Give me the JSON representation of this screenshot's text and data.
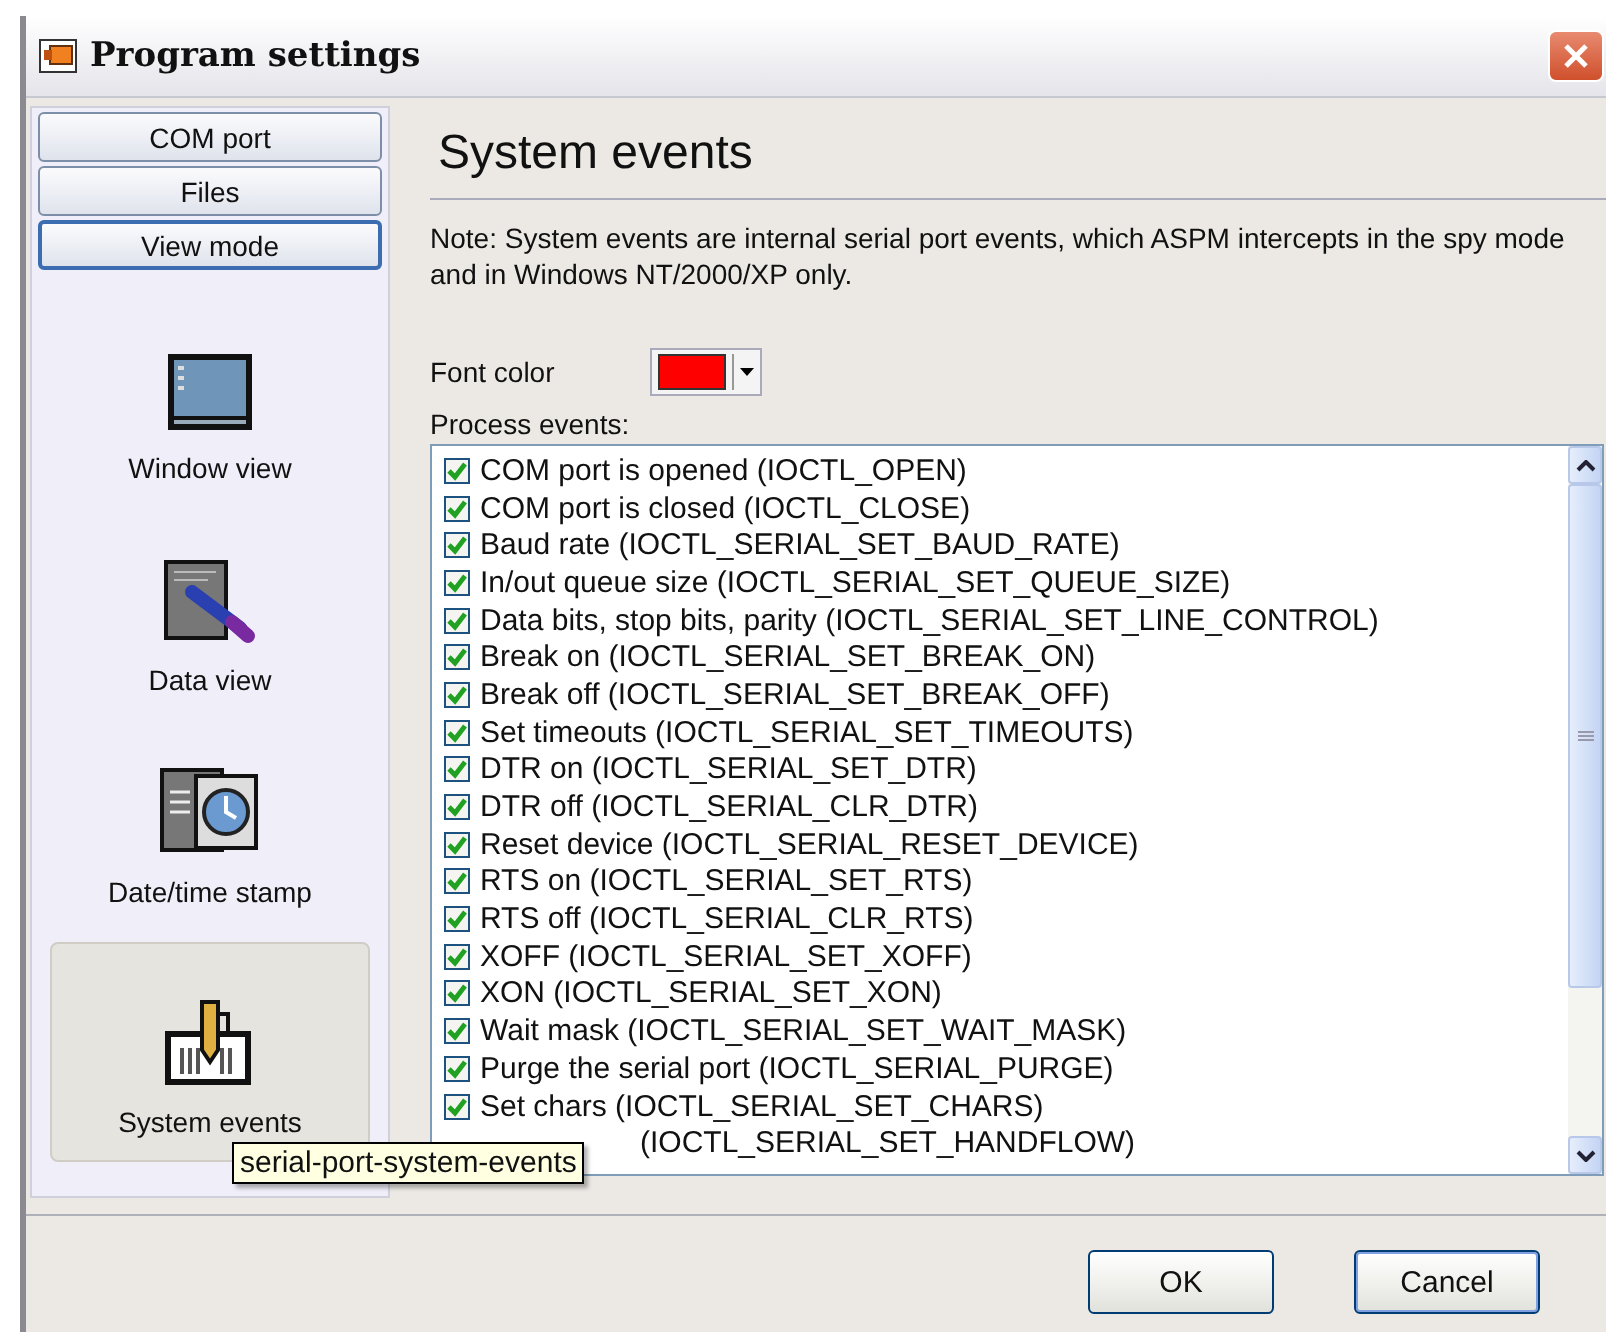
{
  "window": {
    "title": "Program settings"
  },
  "nav_buttons": [
    {
      "label": "COM port",
      "selected": false
    },
    {
      "label": "Files",
      "selected": false
    },
    {
      "label": "View mode",
      "selected": true
    }
  ],
  "view_items": [
    {
      "label": "Window view",
      "kind": "window",
      "selected": false
    },
    {
      "label": "Data view",
      "kind": "data",
      "selected": false
    },
    {
      "label": "Date/time stamp",
      "kind": "clock",
      "selected": false
    },
    {
      "label": "System events",
      "kind": "events",
      "selected": true
    }
  ],
  "panel": {
    "title": "System events",
    "note": "Note: System events are internal serial port events, which ASPM intercepts in the spy mode and in Windows NT/2000/XP only.",
    "font_color": {
      "label": "Font color",
      "color": "#ff0000"
    },
    "list_label": "Process events:"
  },
  "events": [
    {
      "kind": "check",
      "label": "COM port is opened (IOCTL_OPEN)",
      "checked": true
    },
    {
      "kind": "check",
      "label": "COM port is closed (IOCTL_CLOSE)",
      "checked": true
    },
    {
      "kind": "check",
      "label": "Baud rate (IOCTL_SERIAL_SET_BAUD_RATE)",
      "checked": true
    },
    {
      "kind": "check",
      "label": "In/out queue size (IOCTL_SERIAL_SET_QUEUE_SIZE)",
      "checked": true
    },
    {
      "kind": "check",
      "label": "Data bits, stop bits, parity (IOCTL_SERIAL_SET_LINE_CONTROL)",
      "checked": true
    },
    {
      "kind": "check",
      "label": "Break on (IOCTL_SERIAL_SET_BREAK_ON)",
      "checked": true
    },
    {
      "kind": "check",
      "label": "Break off (IOCTL_SERIAL_SET_BREAK_OFF)",
      "checked": true
    },
    {
      "kind": "check",
      "label": "Set timeouts (IOCTL_SERIAL_SET_TIMEOUTS)",
      "checked": true
    },
    {
      "kind": "check",
      "label": "DTR on (IOCTL_SERIAL_SET_DTR)",
      "checked": true
    },
    {
      "kind": "check",
      "label": "DTR off (IOCTL_SERIAL_CLR_DTR)",
      "checked": true
    },
    {
      "kind": "check",
      "label": "Reset device (IOCTL_SERIAL_RESET_DEVICE)",
      "checked": true
    },
    {
      "kind": "check",
      "label": "RTS on (IOCTL_SERIAL_SET_RTS)",
      "checked": true
    },
    {
      "kind": "check",
      "label": "RTS off (IOCTL_SERIAL_CLR_RTS)",
      "checked": true
    },
    {
      "kind": "check",
      "label": "XOFF (IOCTL_SERIAL_SET_XOFF)",
      "checked": true
    },
    {
      "kind": "check",
      "label": "XON (IOCTL_SERIAL_SET_XON)",
      "checked": true
    },
    {
      "kind": "check",
      "label": "Wait mask (IOCTL_SERIAL_SET_WAIT_MASK)",
      "checked": true
    },
    {
      "kind": "check",
      "label": "Purge the serial port (IOCTL_SERIAL_PURGE)",
      "checked": true
    },
    {
      "kind": "check",
      "label": "Set chars (IOCTL_SERIAL_SET_CHARS)",
      "checked": true
    },
    {
      "kind": "partial",
      "label": "(IOCTL_SERIAL_SET_HANDFLOW)"
    }
  ],
  "tooltip": "serial-port-system-events",
  "buttons": [
    "OK",
    "Cancel"
  ]
}
